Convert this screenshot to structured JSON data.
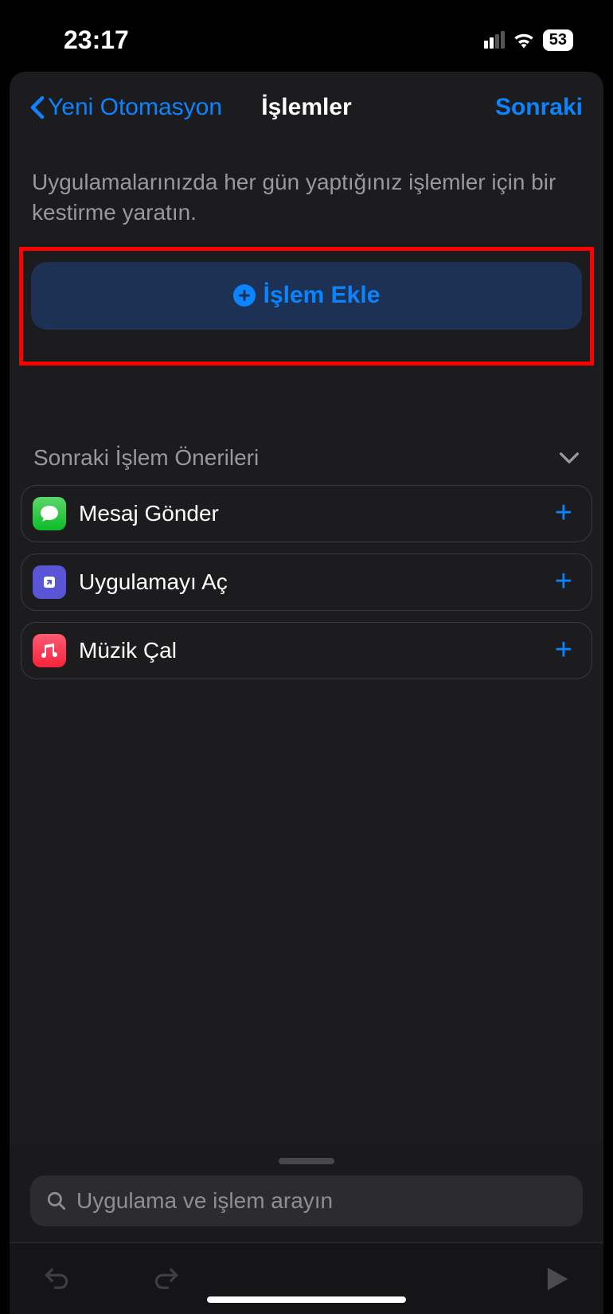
{
  "status": {
    "time": "23:17",
    "battery": "53"
  },
  "nav": {
    "back_label": "Yeni Otomasyon",
    "title": "İşlemler",
    "next_label": "Sonraki"
  },
  "description": "Uygulamalarınızda her gün yaptığınız işlemler için bir kestirme yaratın.",
  "add_action_label": "İşlem Ekle",
  "suggestions": {
    "header": "Sonraki İşlem Önerileri",
    "items": [
      {
        "label": "Mesaj Gönder",
        "icon": "messages"
      },
      {
        "label": "Uygulamayı Aç",
        "icon": "shortcuts"
      },
      {
        "label": "Müzik Çal",
        "icon": "music"
      }
    ]
  },
  "search": {
    "placeholder": "Uygulama ve işlem arayın"
  }
}
